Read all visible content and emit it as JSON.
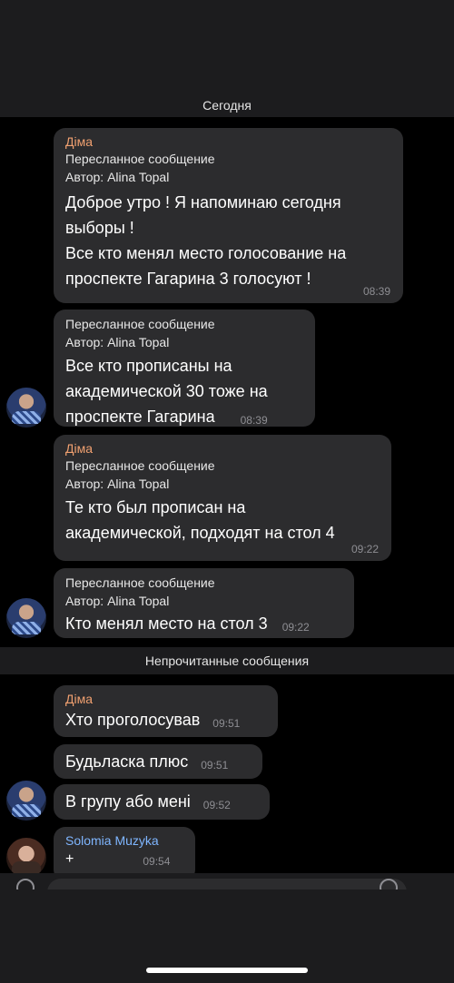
{
  "date_divider": "Сегодня",
  "unread_divider": "Непрочитанные сообщения",
  "messages": [
    {
      "sender": "Діма",
      "forwarded_label": "Пересланное сообщение",
      "author_line": "Автор: Alina Topal",
      "lines": [
        "Доброе утро ! Я напоминаю сегодня",
        "выборы !",
        "Все кто менял место голосование на",
        "проспекте Гагарина 3 голосуют !"
      ],
      "time": "08:39"
    },
    {
      "forwarded_label": "Пересланное сообщение",
      "author_line": "Автор: Alina Topal",
      "lines": [
        "Все кто прописаны на",
        "академической 30 тоже на",
        "проспекте Гагарина"
      ],
      "time": "08:39"
    },
    {
      "sender": "Діма",
      "forwarded_label": "Пересланное сообщение",
      "author_line": "Автор: Alina Topal",
      "lines": [
        "Те кто был прописан на",
        "академической, подходят на стол 4"
      ],
      "time": "09:22"
    },
    {
      "forwarded_label": "Пересланное сообщение",
      "author_line": "Автор: Alina Topal",
      "lines": [
        "Кто менял место на стол 3"
      ],
      "time": "09:22"
    },
    {
      "sender": "Діма",
      "lines": [
        "Хто проголосував"
      ],
      "time": "09:51"
    },
    {
      "lines": [
        "Будьласка плюс"
      ],
      "time": "09:51"
    },
    {
      "lines": [
        "В групу або мені"
      ],
      "time": "09:52"
    },
    {
      "sender": "Solomia Muzyka",
      "lines": [
        "+"
      ],
      "time": "09:54"
    }
  ],
  "colors": {
    "background": "#000000",
    "bubble": "#2c2c2e",
    "sender_dima": "#f0a070",
    "sender_solomia": "#7fb6ff"
  },
  "icons": {
    "avatar_dima": "avatar",
    "avatar_solomia": "avatar",
    "attach": "attach-icon",
    "emoji": "emoji-icon"
  }
}
